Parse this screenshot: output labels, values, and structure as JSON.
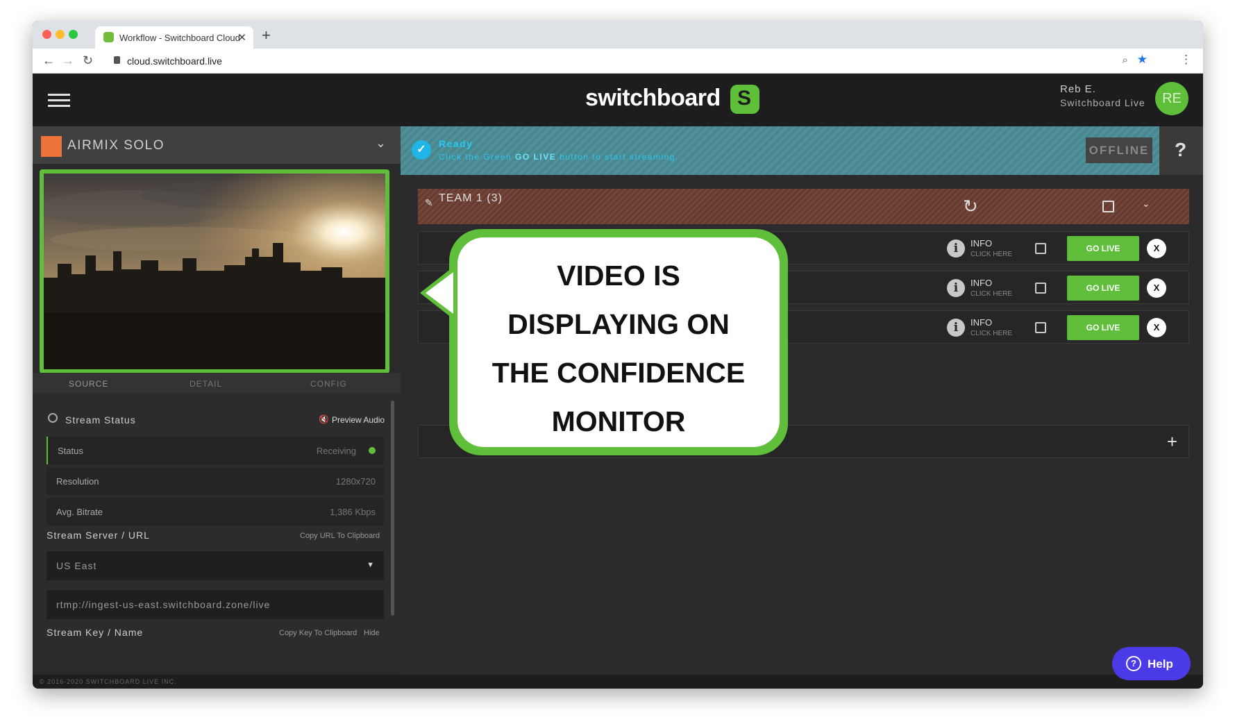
{
  "browser": {
    "tab_title": "Workflow - Switchboard Cloud",
    "tab_close": "✕",
    "new_tab": "+",
    "url": "cloud.switchboard.live",
    "back": "←",
    "forward": "→",
    "reload": "↻",
    "zoom_icon": "⌕",
    "bookmark_icon": "★",
    "menu_icon": "⋮"
  },
  "header": {
    "logo_text": "switchboard",
    "logo_mark": "S",
    "user_name": "Reb E.",
    "user_org": "Switchboard Live",
    "avatar_initials": "RE"
  },
  "source": {
    "name": "AIRMIX SOLO",
    "chevron": "⌄",
    "tabs": [
      "SOURCE",
      "DETAIL",
      "CONFIG"
    ]
  },
  "stream_status": {
    "title": "Stream Status",
    "preview_audio": "Preview Audio",
    "rows": [
      {
        "label": "Status",
        "value": "Receiving"
      },
      {
        "label": "Resolution",
        "value": "1280x720"
      },
      {
        "label": "Avg. Bitrate",
        "value": "1,386 Kbps"
      }
    ],
    "server_title": "Stream Server / URL",
    "copy_url": "Copy URL To Clipboard",
    "region": "US East",
    "url_value": "rtmp://ingest-us-east.switchboard.zone/live",
    "key_title": "Stream Key / Name",
    "copy_key": "Copy Key To Clipboard",
    "hide": "Hide"
  },
  "footer": "© 2016-2020 SWITCHBOARD LIVE INC.",
  "ready": {
    "title": "Ready",
    "subtitle_pre": "Click the Green ",
    "subtitle_strong": "GO LIVE",
    "subtitle_post": " button to start streaming.",
    "offline": "OFFLINE",
    "help_q": "?"
  },
  "team": {
    "name": "TEAM 1 (3)",
    "destinations": [
      {
        "info": "INFO",
        "click": "CLICK HERE",
        "go": "GO LIVE",
        "remove": "X"
      },
      {
        "info": "INFO",
        "click": "CLICK HERE",
        "go": "GO LIVE",
        "remove": "X"
      },
      {
        "info": "INFO",
        "click": "CLICK HERE",
        "go": "GO LIVE",
        "remove": "X"
      }
    ],
    "add": "+"
  },
  "help_button": "Help",
  "callout": {
    "lines": [
      "VIDEO IS",
      "DISPLAYING ON",
      "THE CONFIDENCE",
      "MONITOR"
    ]
  },
  "colors": {
    "accent_green": "#5fbf3a",
    "source_orange": "#ee7338",
    "ready_teal": "#4a8c95",
    "team_brown": "#6b3d30",
    "help_purple": "#4a3ae8"
  }
}
